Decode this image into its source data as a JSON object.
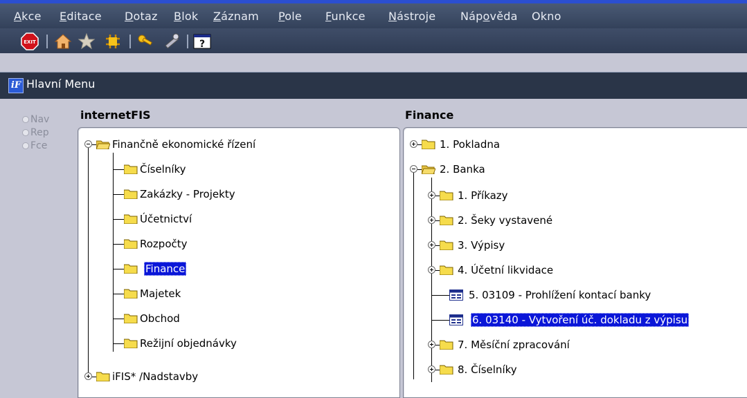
{
  "menu": [
    {
      "u": "A",
      "rest": "kce"
    },
    {
      "u": "E",
      "rest": "ditace"
    },
    {
      "u": "D",
      "rest": "otaz"
    },
    {
      "u": "B",
      "rest": "lok"
    },
    {
      "u": "Z",
      "rest": "áznam"
    },
    {
      "u": "P",
      "rest": "ole"
    },
    {
      "u": "F",
      "rest": "unkce"
    },
    {
      "u": "N",
      "rest": "ástroje"
    },
    {
      "pre": "Náp",
      "u": "o",
      "rest": "věda"
    },
    {
      "u": "",
      "rest": "Okno"
    }
  ],
  "toolbar": {
    "exit_label": "EXIT",
    "help_label": "?"
  },
  "window": {
    "title": "Hlavní Menu",
    "icon_letter": "iF"
  },
  "radios": [
    "Nav",
    "Rep",
    "Fce"
  ],
  "left_panel": {
    "heading": "internetFIS",
    "root": "Finančně ekonomické řízení",
    "children": [
      "Číselníky",
      "Zakázky - Projekty",
      "Účetnictví",
      "Rozpočty",
      "Finance",
      "Majetek",
      "Obchod",
      "Režijní objednávky"
    ],
    "selected": "Finance",
    "after": "iFIS* /Nadstavby"
  },
  "right_panel": {
    "heading": "Finance",
    "top": [
      "1. Pokladna",
      "2. Banka"
    ],
    "children": [
      {
        "label": "1. Příkazy",
        "kind": "folder"
      },
      {
        "label": "2. Šeky vystavené",
        "kind": "folder"
      },
      {
        "label": "3. Výpisy",
        "kind": "folder"
      },
      {
        "label": "4. Účetní likvidace",
        "kind": "folder"
      },
      {
        "label": "5. 03109 - Prohlížení kontací banky",
        "kind": "form"
      },
      {
        "label": "6. 03140 - Vytvoření úč. dokladu z výpisu",
        "kind": "form"
      },
      {
        "label": "7. Měsíční zpracování",
        "kind": "folder"
      },
      {
        "label": "8. Číselníky",
        "kind": "folder"
      }
    ],
    "selected": "6. 03140 - Vytvoření úč. dokladu z výpisu"
  }
}
